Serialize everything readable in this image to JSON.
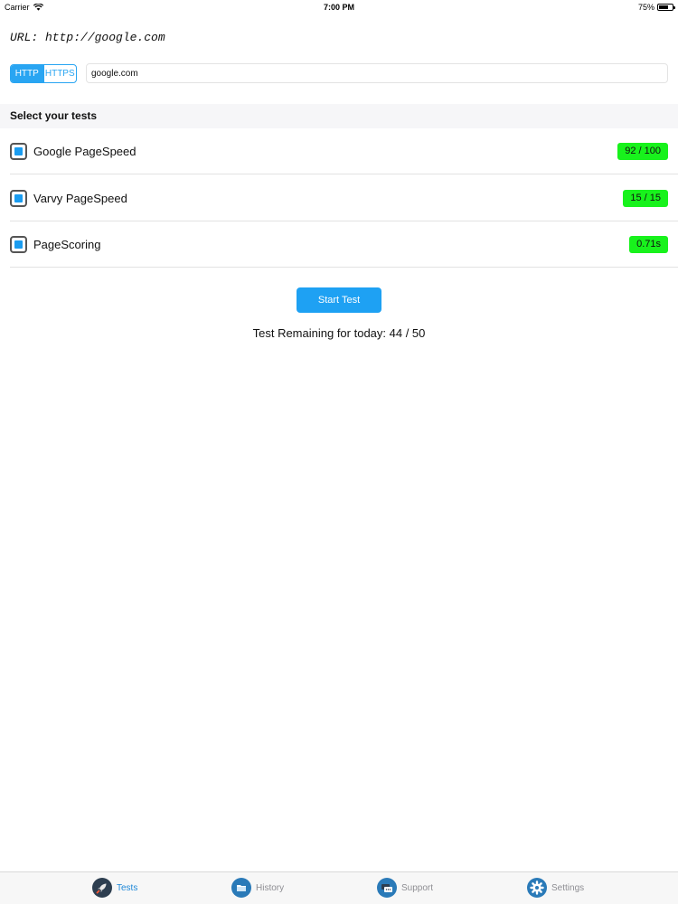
{
  "status_bar": {
    "carrier": "Carrier",
    "time": "7:00 PM",
    "battery": "75%",
    "battery_level": 0.75
  },
  "url_display": "URL: http://google.com",
  "protocol": {
    "options": [
      "HTTP",
      "HTTPS"
    ],
    "selected": "HTTP"
  },
  "url_input": {
    "value": "google.com",
    "placeholder": ""
  },
  "section_title": "Select your tests",
  "tests": [
    {
      "name": "Google PageSpeed",
      "checked": true,
      "score": "92 / 100"
    },
    {
      "name": "Varvy PageSpeed",
      "checked": true,
      "score": "15 / 15"
    },
    {
      "name": "PageScoring",
      "checked": true,
      "score": "0.71s"
    }
  ],
  "start_button": "Start Test",
  "remaining_text": "Test Remaining for today: 44 / 50",
  "tab_bar": {
    "items": [
      {
        "label": "Tests",
        "icon": "rocket-icon",
        "active": true
      },
      {
        "label": "History",
        "icon": "folder-icon",
        "active": false
      },
      {
        "label": "Support",
        "icon": "chat-icon",
        "active": false
      },
      {
        "label": "Settings",
        "icon": "gear-icon",
        "active": false
      }
    ]
  },
  "colors": {
    "accent": "#1ea1f3",
    "score_bg": "#18f21c",
    "tab_active": "#1e88d8"
  }
}
